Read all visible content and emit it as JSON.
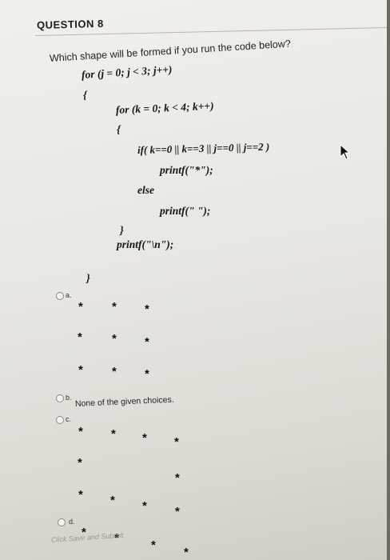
{
  "question": {
    "title": "QUESTION 8",
    "text": "Which shape will be formed if you run the code below?"
  },
  "code": {
    "line1": "for (j = 0; j < 3; j++)",
    "line2": "{",
    "line3": "for (k = 0; k < 4; k++)",
    "line4": "{",
    "line5": "if( k==0 || k==3 || j==0 || j==2 )",
    "line6": "printf(\"*\");",
    "line7": "else",
    "line8": "printf(\" \");",
    "line9": "}",
    "line10": "printf(\"\\n\");",
    "line11": "}"
  },
  "options": {
    "a": {
      "label": "a.",
      "star": "*"
    },
    "b": {
      "label": "b.",
      "text": "None of the given choices."
    },
    "c": {
      "label": "c.",
      "star": "*"
    },
    "d": {
      "label": "d.",
      "star": "*"
    }
  },
  "footer": {
    "text": "Click Save and Submit"
  },
  "icons": {
    "cursor": "mouse-pointer-icon"
  }
}
